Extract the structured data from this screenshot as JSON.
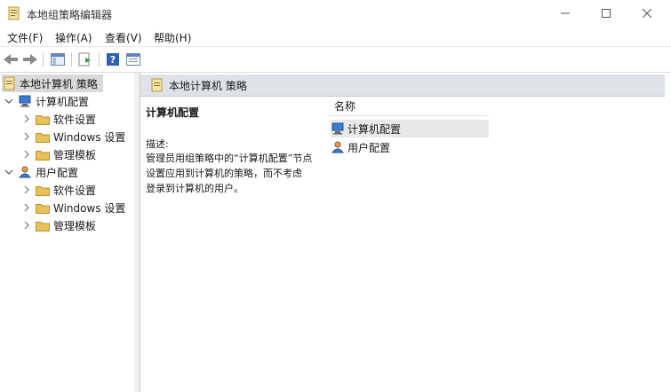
{
  "window": {
    "title": "本地组策略编辑器"
  },
  "menu": [
    "文件(F)",
    "操作(A)",
    "查看(V)",
    "帮助(H)"
  ],
  "tree": {
    "root": "本地计算机 策略",
    "computer": {
      "label": "计算机配置",
      "children": [
        "软件设置",
        "Windows 设置",
        "管理模板"
      ]
    },
    "user": {
      "label": "用户配置",
      "children": [
        "软件设置",
        "Windows 设置",
        "管理模板"
      ]
    }
  },
  "right": {
    "header": "本地计算机 策略",
    "detail_title": "计算机配置",
    "desc_label": "描述:",
    "desc_lines": [
      "管理员用组策略中的“计算机配置”节点",
      "设置应用到计算机的策略，而不考虑",
      "登录到计算机的用户。"
    ],
    "column_name": "名称",
    "rows": [
      "计算机配置",
      "用户配置"
    ]
  },
  "colors": {
    "header_bg": "#dfe3e8",
    "selection": "#d9d9d9",
    "folder": "#e8c15a"
  }
}
